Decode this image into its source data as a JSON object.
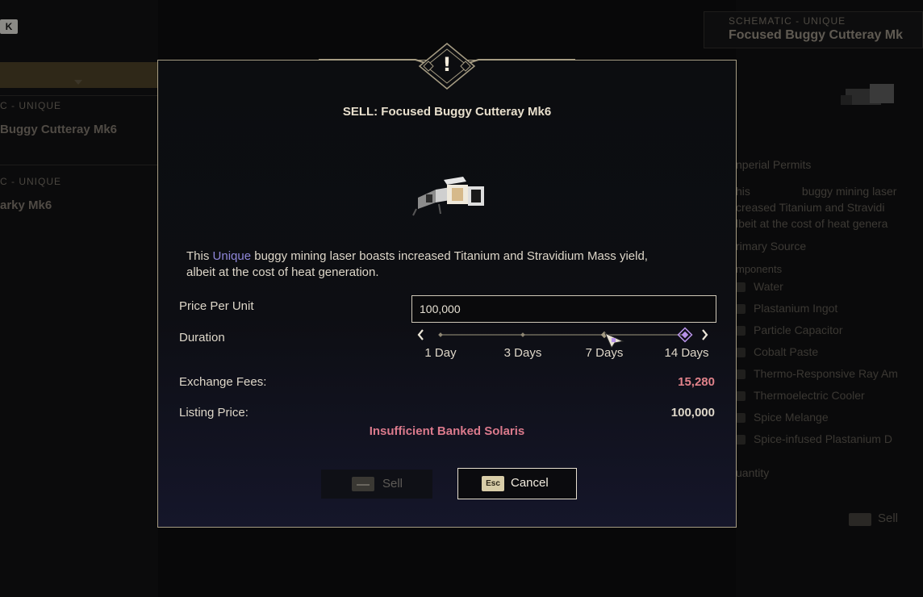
{
  "background": {
    "left": {
      "key_hint": "K",
      "entries": [
        {
          "subtitle": "C - UNIQUE",
          "name": "Buggy Cutteray Mk6"
        },
        {
          "subtitle": "C - UNIQUE",
          "name": "arky Mk6"
        }
      ]
    },
    "right": {
      "header_subtitle": "SCHEMATIC - UNIQUE",
      "header_name": "Focused Buggy Cutteray Mk",
      "section_label": "nperial Permits",
      "desc_lines": [
        "his",
        "creased Titanium and Stravidi",
        "lbeit at the cost of heat genera"
      ],
      "desc_word": "buggy mining laser",
      "primary_source": "rimary Source",
      "components_label": "mponents",
      "components": [
        "Water",
        "Plastanium Ingot",
        "Particle Capacitor",
        "Cobalt Paste",
        "Thermo-Responsive Ray Am",
        "Thermoelectric Cooler",
        "Spice Melange",
        "Spice-infused Plastanium D"
      ],
      "quantity_label": "uantity",
      "sell_label": "Sell"
    }
  },
  "modal": {
    "title": "SELL: Focused Buggy Cutteray Mk6",
    "alert_symbol": "!",
    "description": {
      "prefix": "This ",
      "highlight": "Unique",
      "line1_rest": " buggy mining laser boasts increased Titanium and Stravidium Mass yield,",
      "line2": "albeit at the cost of heat generation."
    },
    "price_label": "Price Per Unit",
    "price_value": "100,000",
    "duration_label": "Duration",
    "duration_options": [
      "1 Day",
      "3 Days",
      "7 Days",
      "14 Days"
    ],
    "duration_selected_index": 3,
    "fees_label": "Exchange Fees:",
    "fees_value": "15,280",
    "listing_label": "Listing Price:",
    "listing_value": "100,000",
    "warning": "Insufficient Banked Solaris",
    "sell_button": "Sell",
    "cancel_button": "Cancel",
    "cancel_key": "Esc"
  },
  "colors": {
    "border_gold": "#a69c83",
    "unique_purple": "#8f87d9",
    "warning_red": "#db7a8c",
    "fees_red": "#e0828a",
    "selected_diamond": "#b792e8"
  }
}
